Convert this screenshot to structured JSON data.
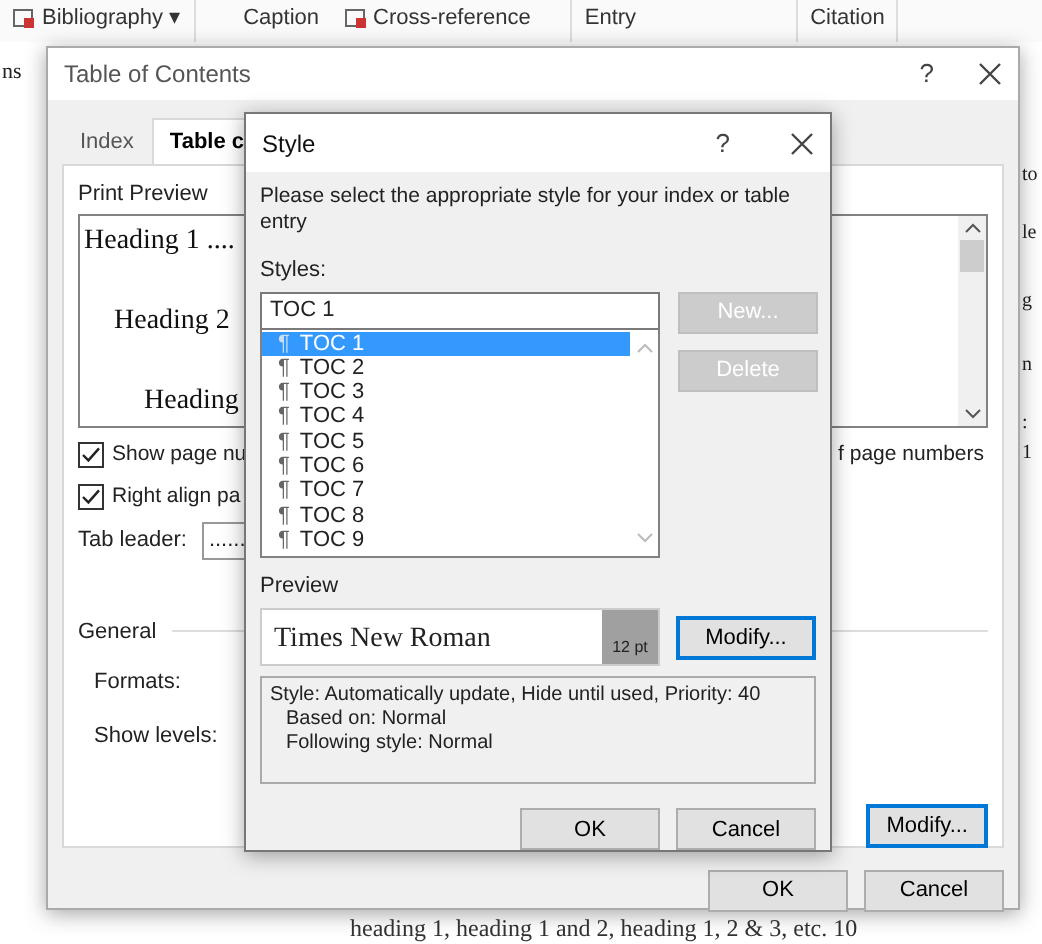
{
  "ribbon": {
    "items": [
      {
        "label": "Bibliography ▾",
        "kind": "icon"
      },
      {
        "label": "Caption",
        "kind": "plain"
      },
      {
        "label": "Cross-reference",
        "kind": "icon"
      },
      {
        "label": "Entry",
        "kind": "plain"
      },
      {
        "label": "Citation",
        "kind": "plain"
      }
    ]
  },
  "document": {
    "left_fragment": "ns",
    "right_fragments": [
      "to",
      "le",
      "g",
      "n",
      ": 1"
    ],
    "bottom_text": "heading 1, heading 1 and 2, heading 1, 2 & 3, etc. 10"
  },
  "toc_dialog": {
    "title": "Table of Contents",
    "help": "?",
    "tabs": [
      {
        "label": "Index",
        "selected": false
      },
      {
        "label": "Table c",
        "selected": true
      }
    ],
    "print_preview": {
      "label": "Print Preview",
      "lines": [
        "Heading 1 ....",
        "Heading 2",
        "Heading"
      ]
    },
    "checkboxes": [
      {
        "label": "Show page nu",
        "checked": true
      },
      {
        "label": "Right align pa",
        "checked": true
      }
    ],
    "right_text": "f page numbers",
    "tab_leader": {
      "label": "Tab leader:",
      "value": "......"
    },
    "general": {
      "label": "General",
      "fields": [
        "Formats:",
        "Show levels:"
      ]
    },
    "modify_button": "Modify...",
    "buttons": [
      "OK",
      "Cancel"
    ]
  },
  "style_dialog": {
    "title": "Style",
    "help": "?",
    "instruction": "Please select the appropriate style for your index or table entry",
    "styles_label": "Styles:",
    "styles_value": "TOC 1",
    "style_list": [
      {
        "symbol": "¶",
        "label": "TOC 1",
        "selected": true
      },
      {
        "symbol": "¶",
        "label": "TOC 2",
        "selected": false
      },
      {
        "symbol": "¶",
        "label": "TOC 3",
        "selected": false
      },
      {
        "symbol": "¶",
        "label": "TOC 4",
        "selected": false
      },
      {
        "symbol": "¶",
        "label": "TOC 5",
        "selected": false
      },
      {
        "symbol": "¶",
        "label": "TOC 6",
        "selected": false
      },
      {
        "symbol": "¶",
        "label": "TOC 7",
        "selected": false
      },
      {
        "symbol": "¶",
        "label": "TOC 8",
        "selected": false
      },
      {
        "symbol": "¶",
        "label": "TOC 9",
        "selected": false
      }
    ],
    "side_buttons": [
      {
        "label": "New...",
        "disabled": true
      },
      {
        "label": "Delete",
        "disabled": true
      }
    ],
    "preview_label": "Preview",
    "preview": {
      "font": "Times New Roman",
      "size": "12 pt"
    },
    "modify_button": "Modify...",
    "description": [
      "Style: Automatically update, Hide until used, Priority: 40",
      "Based on: Normal",
      "Following style: Normal"
    ],
    "buttons": [
      "OK",
      "Cancel"
    ]
  }
}
